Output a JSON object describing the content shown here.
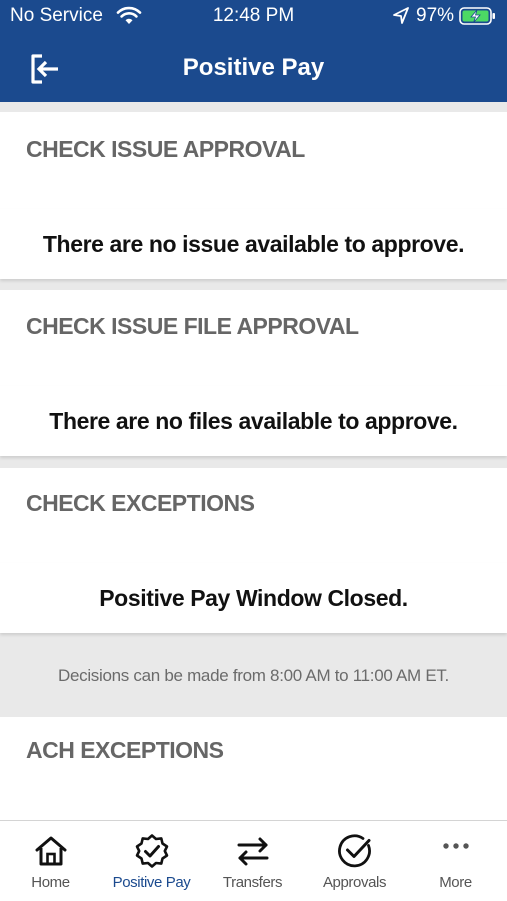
{
  "status_bar": {
    "carrier": "No Service",
    "time": "12:48 PM",
    "battery": "97%"
  },
  "header": {
    "title": "Positive Pay",
    "logout_icon": "logout-icon"
  },
  "sections": {
    "check_issue_approval": {
      "title": "CHECK ISSUE APPROVAL",
      "message": "There are no issue available to approve."
    },
    "check_issue_file_approval": {
      "title": "CHECK ISSUE FILE APPROVAL",
      "message": "There are no files available to approve."
    },
    "check_exceptions": {
      "title": "CHECK EXCEPTIONS",
      "message": "Positive Pay Window Closed.",
      "info": "Decisions can be made from 8:00 AM to 11:00 AM ET."
    },
    "ach_exceptions": {
      "title": "ACH EXCEPTIONS"
    }
  },
  "tabs": [
    {
      "label": "Home",
      "icon": "home-icon"
    },
    {
      "label": "Positive Pay",
      "icon": "badge-check-icon",
      "active": true
    },
    {
      "label": "Transfers",
      "icon": "transfer-arrows-icon"
    },
    {
      "label": "Approvals",
      "icon": "check-circle-icon"
    },
    {
      "label": "More",
      "icon": "more-dots-icon"
    }
  ],
  "colors": {
    "brand": "#1b4a8e",
    "background": "#e9e9e9",
    "section_title": "#666666"
  }
}
